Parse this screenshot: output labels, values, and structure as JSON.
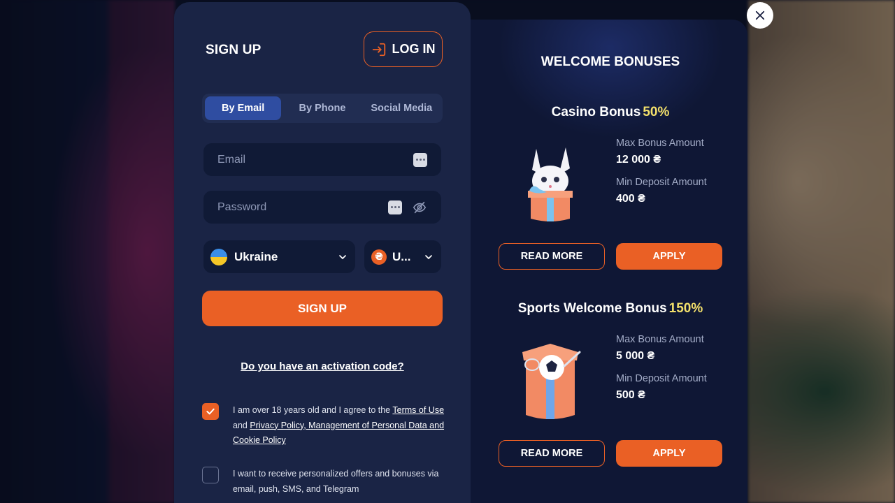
{
  "colors": {
    "accent": "#ea6025",
    "panel": "#1a2445",
    "tab_active": "#2f4da1",
    "highlight": "#f3e06b"
  },
  "signup": {
    "title": "SIGN UP",
    "login_label": "LOG IN",
    "tabs": [
      {
        "label": "By Email",
        "active": true
      },
      {
        "label": "By Phone",
        "active": false
      },
      {
        "label": "Social Media",
        "active": false
      }
    ],
    "email_placeholder": "Email",
    "password_placeholder": "Password",
    "country": "Ukraine",
    "currency": "U...",
    "currency_symbol": "₴",
    "submit_label": "SIGN UP",
    "activation_link": "Do you have an activation code?",
    "terms": {
      "checked": true,
      "text_1": "I am over 18 years old and I agree to the ",
      "link_terms": "Terms of Use",
      "text_2": " and ",
      "link_privacy": "Privacy Policy, Management of Personal Data and Cookie Policy"
    },
    "offers": {
      "checked": false,
      "text": "I want to receive personalized offers and bonuses via email, push, SMS, and Telegram"
    }
  },
  "bonuses": {
    "title": "WELCOME BONUSES",
    "items": [
      {
        "name": "Casino Bonus",
        "percent": "50%",
        "max_label": "Max Bonus Amount",
        "max_value": "12 000 ₴",
        "min_label": "Min Deposit Amount",
        "min_value": "400 ₴",
        "read_more": "READ MORE",
        "apply": "APPLY"
      },
      {
        "name": "Sports Welcome Bonus",
        "percent": "150%",
        "max_label": "Max Bonus Amount",
        "max_value": "5 000 ₴",
        "min_label": "Min Deposit Amount",
        "min_value": "500 ₴",
        "read_more": "READ MORE",
        "apply": "APPLY"
      }
    ]
  }
}
